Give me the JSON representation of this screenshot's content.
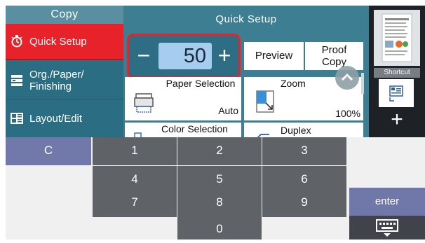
{
  "left_nav": {
    "title": "Copy",
    "items": [
      {
        "label": "Quick Setup",
        "icon": "quick-setup-icon",
        "selected": true
      },
      {
        "label": "Org./Paper/\nFinishing",
        "icon": "org-paper-icon"
      },
      {
        "label": "Layout/Edit",
        "icon": "layout-edit-icon"
      }
    ]
  },
  "main": {
    "title": "Quick Setup",
    "copies": {
      "value": "50",
      "minus": "−",
      "plus": "+"
    },
    "preview_label": "Preview",
    "proof_label": "Proof\nCopy",
    "paper_selection": {
      "title": "Paper Selection",
      "value": "Auto"
    },
    "zoom": {
      "title": "Zoom",
      "value": "100%"
    },
    "color_selection": {
      "title": "Color Selection"
    },
    "duplex": {
      "title": "Duplex"
    }
  },
  "right": {
    "shortcut_label": "Shortcut",
    "add_label": "+"
  },
  "keypad": {
    "clear": "C",
    "keys": [
      "1",
      "2",
      "3",
      "4",
      "5",
      "6",
      "7",
      "8",
      "9",
      "0"
    ],
    "enter": "enter"
  },
  "colors": {
    "accent_red": "#e8222b",
    "nav_bg": "#2b6e83",
    "key_bg": "#5f6266",
    "enter_bg": "#6f78a9"
  }
}
